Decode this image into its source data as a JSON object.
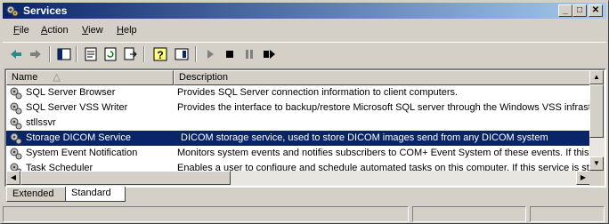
{
  "window": {
    "title": "Services",
    "controls": {
      "minimize": "_",
      "maximize": "□",
      "close": "✕"
    }
  },
  "menu": {
    "items": [
      {
        "label": "ile",
        "mnemonic": "F"
      },
      {
        "label": "ction",
        "mnemonic": "A"
      },
      {
        "label": "iew",
        "mnemonic": "V"
      },
      {
        "label": "elp",
        "mnemonic": "H"
      }
    ]
  },
  "toolbar": {
    "icons": [
      "back-arrow-icon",
      "forward-arrow-icon",
      "show-hide-tree-icon",
      "properties-icon",
      "refresh-icon",
      "export-list-icon",
      "help-icon",
      "console-tree-icon",
      "play-icon",
      "stop-icon",
      "pause-icon",
      "restart-icon"
    ]
  },
  "list": {
    "columns": {
      "name": "Name",
      "sort_indicator": "△",
      "description": "Description"
    },
    "rows": [
      {
        "name": "SQL Server Browser",
        "description": "Provides SQL Server connection information to client computers."
      },
      {
        "name": "SQL Server VSS Writer",
        "description": "Provides the interface to backup/restore Microsoft SQL server through the Windows VSS infrastr"
      },
      {
        "name": "stllssvr",
        "description": ""
      },
      {
        "name": "Storage DICOM Service",
        "description": "DICOM storage service, used to store DICOM images send from any DICOM system",
        "selected": true
      },
      {
        "name": "System Event Notification",
        "description": "Monitors system events and notifies subscribers to COM+ Event System of these events. If this"
      },
      {
        "name": "Task Scheduler",
        "description": "Enables a user to configure and schedule automated tasks on this computer. If this service is sto"
      }
    ]
  },
  "tabs": [
    {
      "label": "Extended"
    },
    {
      "label": "Standard",
      "active": true
    }
  ],
  "colors": {
    "titlebar_start": "#0a246a",
    "titlebar_end": "#a6caf0",
    "selection": "#0a246a",
    "face": "#d4d0c8"
  }
}
